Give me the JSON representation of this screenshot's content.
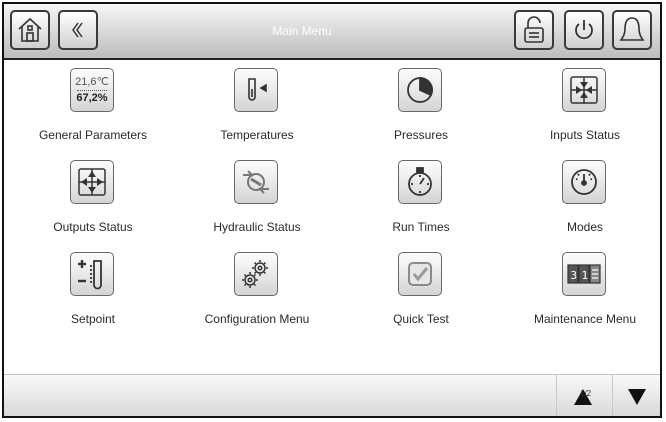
{
  "header": {
    "title": "Main Menu"
  },
  "menu": {
    "items": [
      {
        "label": "General Parameters",
        "icon": "general-parameters-icon",
        "value_top": "21,6℃",
        "value_bottom": "67,2%"
      },
      {
        "label": "Temperatures",
        "icon": "thermometer-icon"
      },
      {
        "label": "Pressures",
        "icon": "pressure-gauge-icon"
      },
      {
        "label": "Inputs Status",
        "icon": "inputs-arrows-icon"
      },
      {
        "label": "Outputs Status",
        "icon": "outputs-arrows-icon"
      },
      {
        "label": "Hydraulic Status",
        "icon": "pump-icon"
      },
      {
        "label": "Run Times",
        "icon": "stopwatch-icon"
      },
      {
        "label": "Modes",
        "icon": "mode-dial-icon"
      },
      {
        "label": "Setpoint",
        "icon": "setpoint-icon"
      },
      {
        "label": "Configuration Menu",
        "icon": "gears-icon"
      },
      {
        "label": "Quick Test",
        "icon": "checkbox-icon"
      },
      {
        "label": "Maintenance Menu",
        "icon": "calendar-counter-icon"
      }
    ]
  },
  "pagination": {
    "page_label": "1/2"
  },
  "colors": {
    "title_text": "#ffffff",
    "icon_stroke": "#333333"
  }
}
